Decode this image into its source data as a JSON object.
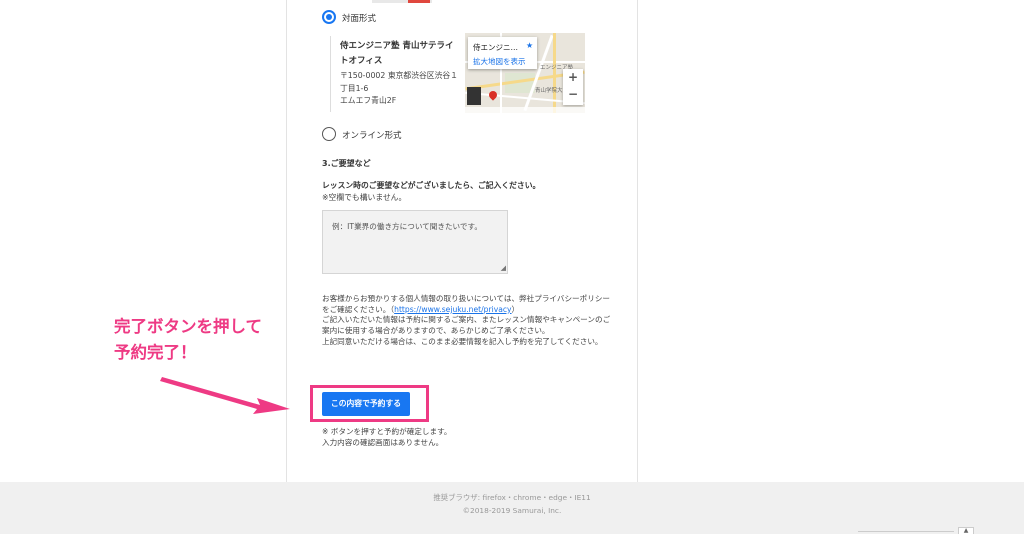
{
  "format": {
    "in_person_label": "対面形式",
    "online_label": "オンライン形式",
    "in_person_selected": true
  },
  "venue": {
    "name": "侍エンジニア塾 青山サテライトオフィス",
    "address_lines": [
      "〒150-0002 東京都渋谷区渋谷１",
      "丁目1-6",
      "エムエフ青山2F"
    ],
    "map": {
      "card_title": "侍エンジニ…",
      "card_link": "拡大地図を表示",
      "zoom_in": "+",
      "zoom_out": "−",
      "labels": [
        "エンジニア塾",
        "青山学院大"
      ]
    }
  },
  "requests": {
    "title": "3.ご要望など",
    "line1": "レッスン時のご要望などがございましたら、ご記入ください。",
    "line2": "※空欄でも構いません。",
    "placeholder": "例：IT業界の働き方について聞きたいです。"
  },
  "privacy": {
    "part1": "お客様からお預かりする個人情報の取り扱いについては、弊社プライバシーポリシーをご確認ください。（",
    "link": "https://www.sejuku.net/privacy",
    "part2": "）",
    "part3": "ご記入いただいた情報は予約に関するご案内、またレッスン情報やキャンペーンのご案内に使用する場合がありますので、あらかじめご了承ください。",
    "part4": "上記同意いただける場合は、このまま必要情報を記入し予約を完了してください。"
  },
  "submit": {
    "label": "この内容で予約する",
    "note1": "※ ボタンを押すと予約が確定します。",
    "note2": "入力内容の確認画面はありません。"
  },
  "annotation": {
    "line1": "完了ボタンを押して",
    "line2": "予約完了！"
  },
  "footer": {
    "browsers": "推奨ブラウザ: firefox・chrome・edge・IE11",
    "copyright": "©2018-2019 Samurai, Inc."
  },
  "colors": {
    "accent": "#1877f2",
    "annotation": "#ee3a84"
  },
  "icons": {
    "scroll_top": "chevron-up-icon",
    "favorite": "star-icon"
  }
}
